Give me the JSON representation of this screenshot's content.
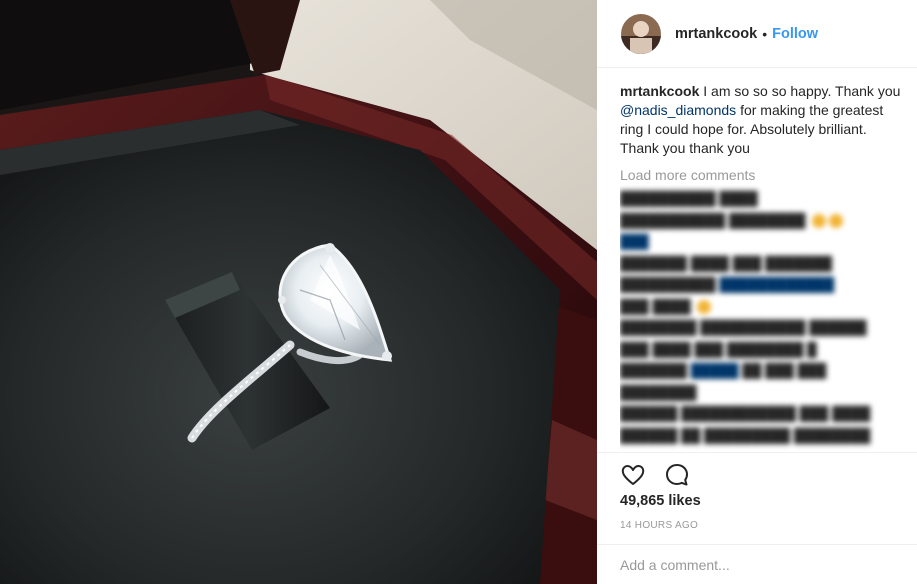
{
  "post": {
    "username": "mrtankcook",
    "separator": "•",
    "follow_label": "Follow",
    "caption": {
      "username": "mrtankcook",
      "text_before_mention": "I am so so so happy. Thank you",
      "mention": "@nadis_diamonds",
      "text_after_mention": "for making the greatest ring I could hope for. Absolutely brilliant. Thank you thank you"
    },
    "load_more_label": "Load more comments",
    "likes": "49,865 likes",
    "timestamp": "14 HOURS AGO",
    "comment_placeholder": "Add a comment..."
  },
  "icons": {
    "like": "heart-icon",
    "comment": "comment-bubble-icon"
  },
  "colors": {
    "link_blue": "#3897f0",
    "mention_blue": "#003569",
    "muted_gray": "#999999",
    "text": "#262626"
  }
}
